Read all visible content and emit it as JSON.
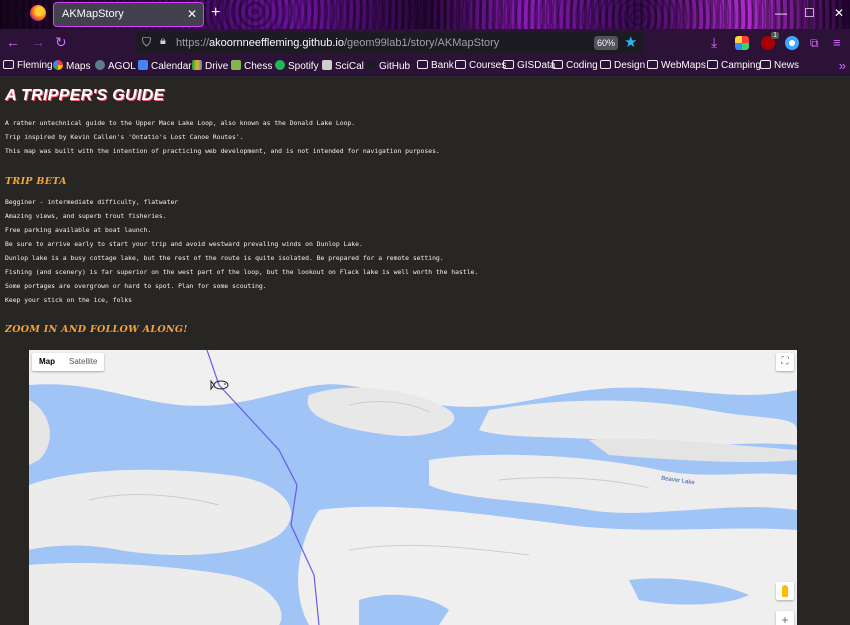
{
  "browser": {
    "tab_title": "AKMapStory",
    "tab_close": "✕",
    "new_tab": "+",
    "url_scheme": "https://",
    "url_host": "akoornneeffleming.github.io",
    "url_path": "/geom99lab1/story/AKMapStory",
    "zoom_level": "60%",
    "window_controls": {
      "minimize": "—",
      "maximize": "☐",
      "close": "✕"
    },
    "extension_badge": "1"
  },
  "bookmarks": [
    {
      "label": "Fleming",
      "icon": "folder-icon"
    },
    {
      "label": "Maps",
      "icon": "google-icon"
    },
    {
      "label": "AGOL",
      "icon": "globe-icon"
    },
    {
      "label": "Calendar",
      "icon": "calendar-icon"
    },
    {
      "label": "Drive",
      "icon": "drive-icon"
    },
    {
      "label": "Chess",
      "icon": "chess-icon"
    },
    {
      "label": "Spotify",
      "icon": "spotify-icon"
    },
    {
      "label": "SciCal",
      "icon": "calculator-icon"
    },
    {
      "label": "GitHub",
      "icon": "github-icon"
    },
    {
      "label": "Bank",
      "icon": "folder-icon"
    },
    {
      "label": "Courses",
      "icon": "folder-icon"
    },
    {
      "label": "GISData",
      "icon": "folder-icon"
    },
    {
      "label": "Coding",
      "icon": "folder-icon"
    },
    {
      "label": "Design",
      "icon": "folder-icon"
    },
    {
      "label": "WebMaps",
      "icon": "folder-icon"
    },
    {
      "label": "Camping",
      "icon": "folder-icon"
    },
    {
      "label": "News",
      "icon": "folder-icon"
    }
  ],
  "page": {
    "title": "A TRIPPER'S GUIDE",
    "intro": [
      "A rather untechnical guide to the Upper Mace Lake Loop, also known as the Donald Lake Loop.",
      "Trip inspired by Kevin Callen's 'Ontatio's Lost Canoe Routes'.",
      "This map was built with the intention of practicing web development, and is not intended for navigation purposes."
    ],
    "trip_beta_heading": "TRIP BETA",
    "trip_beta": [
      "Begginer - intermediate difficulty, flatwater",
      "Amazing views, and superb trout fisheries.",
      "Free parking available at boat launch.",
      "Be sure to arrive early to start your trip and avoid westward prevaling winds on Dunlop Lake.",
      "Dunlop lake is a busy cottage lake, but the rest of the route is quite isolated. Be prepared for a remote setting.",
      "Fishing (and scenery) is far superior on the west part of the loop, but the lookout on Flack lake is well worth the hastle.",
      "Some portages are overgrown or hard to spot. Plan for some scouting.",
      "Keep your stick on the ice, folks"
    ],
    "map_heading": "ZOOM IN AND FOLLOW ALONG!"
  },
  "map": {
    "type_map": "Map",
    "type_satellite": "Satellite",
    "lake_label": "Beaver Lake",
    "fullscreen": "⛶",
    "zoom_in": "+",
    "water_color": "#9fc4f5",
    "land_color": "#f2f2f2",
    "route_color": "#6a5be8"
  }
}
